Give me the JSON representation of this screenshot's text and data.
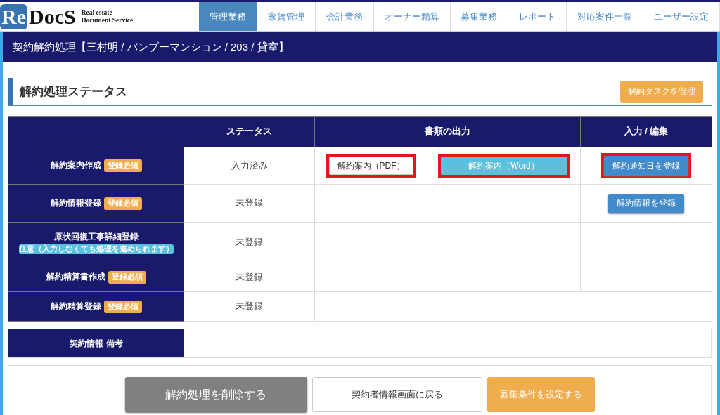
{
  "logo": {
    "mark": "Re",
    "name": "DocS",
    "tagline_1": "Real estate",
    "tagline_2": "Document Service"
  },
  "nav": [
    {
      "label": "管理業務",
      "selected": true
    },
    {
      "label": "家賃管理",
      "selected": false
    },
    {
      "label": "会計業務",
      "selected": false
    },
    {
      "label": "オーナー精算",
      "selected": false
    },
    {
      "label": "募集業務",
      "selected": false
    },
    {
      "label": "レポート",
      "selected": false
    },
    {
      "label": "対応案件一覧",
      "selected": false
    },
    {
      "label": "ユーザー設定",
      "selected": false
    }
  ],
  "page_title": "契約解約処理【三村明 / バンブーマンション / 203 / 貸室】",
  "section": {
    "heading": "解約処理ステータス",
    "manage_button": "解約タスクを管理"
  },
  "table": {
    "headers": {
      "status": "ステータス",
      "documents": "書類の出力",
      "edit": "入力 / 編集"
    },
    "rows": [
      {
        "label": "解約案内作成",
        "badge": {
          "kind": "required",
          "text": "登録必須"
        },
        "status": "入力済み",
        "kind": "split",
        "documents": [
          {
            "label": "解約案内（PDF）",
            "kind": "plain",
            "highlighted": true
          },
          {
            "label": "解約案内（Word）",
            "kind": "info",
            "highlighted": true
          }
        ],
        "edit": {
          "label": "解約通知日を登録",
          "highlighted": true
        }
      },
      {
        "label": "解約情報登録",
        "badge": {
          "kind": "required",
          "text": "登録必須"
        },
        "status": "未登録",
        "kind": "split",
        "edit": {
          "label": "解約情報を登録",
          "highlighted": false
        }
      },
      {
        "label": "原状回復工事詳細登録",
        "badge": {
          "kind": "optional",
          "text": "任意（入力しなくても処理を進められます）"
        },
        "status": "未登録",
        "kind": "merged"
      },
      {
        "label": "解約精算書作成",
        "badge": {
          "kind": "required",
          "text": "登録必須"
        },
        "status": "未登録",
        "kind": "merged"
      },
      {
        "label": "解約精算登録",
        "badge": {
          "kind": "required",
          "text": "登録必須"
        },
        "status": "未登録",
        "kind": "open"
      }
    ]
  },
  "memo": {
    "label": "契約情報 備考"
  },
  "footer_buttons": [
    {
      "label": "解約処理を削除する",
      "kind": "delete"
    },
    {
      "label": "契約者情報画面に戻る",
      "kind": "back"
    },
    {
      "label": "募集条件を設定する",
      "kind": "action"
    }
  ]
}
